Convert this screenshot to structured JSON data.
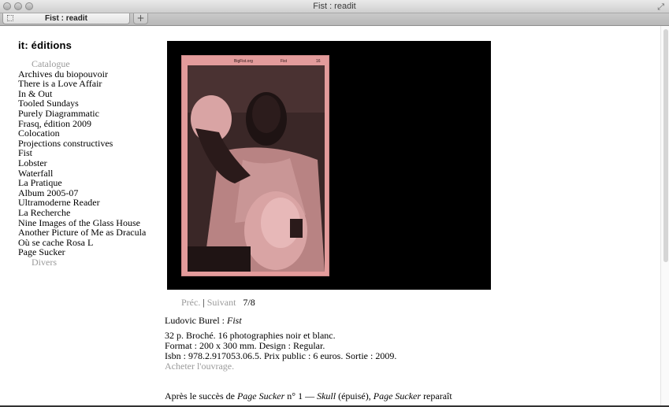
{
  "window": {
    "title": "Fist : readit"
  },
  "tabs": [
    {
      "label": "Fist : readit"
    }
  ],
  "new_tab_icon": "plus-icon",
  "site": {
    "logo": "it: éditions"
  },
  "nav": {
    "catalogue_label": "Catalogue",
    "items": [
      "Archives du biopouvoir",
      "There is a Love Affair",
      "In & Out",
      "Tooled Sundays",
      "Purely Diagrammatic",
      "Frasq, édition 2009",
      "Colocation",
      "Projections constructives",
      "Fist",
      "Lobster",
      "Waterfall",
      "La Pratique",
      "Album 2005-07",
      "Ultramoderne Reader",
      "La Recherche",
      "Nine Images of the Glass House",
      "Another Picture of Me as Dracula",
      "Où se cache Rosa L",
      "Page Sucker"
    ],
    "divers_label": "Divers"
  },
  "hero": {
    "zine_header_left": "BigFist.org",
    "zine_header_center": "Fist",
    "zine_header_right": "16"
  },
  "pager": {
    "prev": "Préc.",
    "separator": "|",
    "next": "Suivant",
    "count": "7/8"
  },
  "info": {
    "author": "Ludovic Burel : ",
    "title": "Fist",
    "line1": "32 p. Broché. 16 photographies noir et blanc.",
    "line2": "Format : 200 x 300 mm. Design : Regular.",
    "line3": "Isbn : 978.2.917053.06.5. Prix public : 6 euros. Sortie : 2009.",
    "buy": "Acheter l'ouvrage.",
    "desc_1": "Après le succès de ",
    "desc_2": "Page Sucker",
    "desc_3": " n° 1 — ",
    "desc_4": "Skull",
    "desc_5": " (épuisé), ",
    "desc_6": "Page Sucker",
    "desc_7": " reparaît"
  },
  "colors": {
    "link_grey": "#9a9a9a",
    "zine_pink": "#e39b9b",
    "hero_bg": "#000000"
  }
}
